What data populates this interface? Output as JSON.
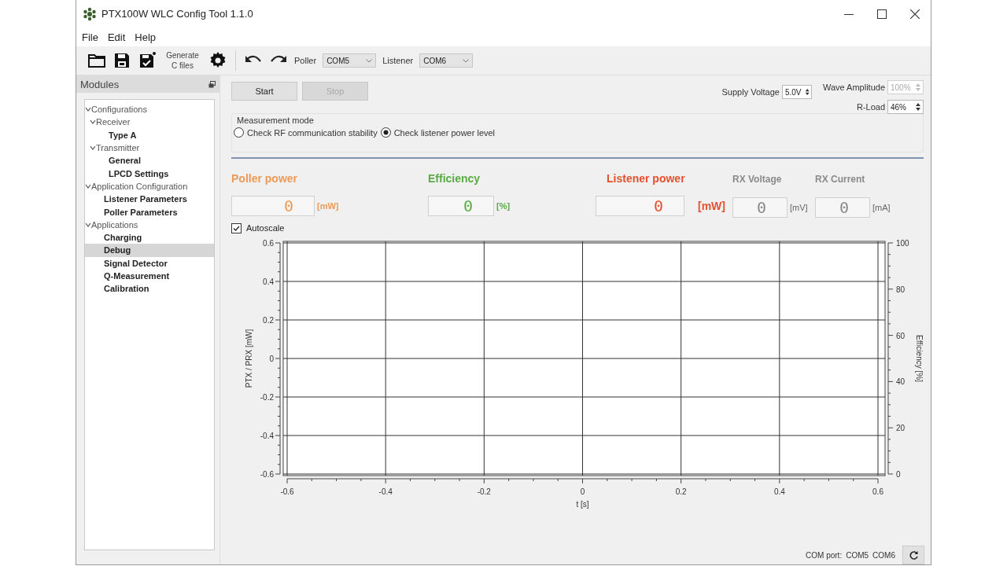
{
  "window": {
    "title": "PTX100W WLC Config Tool 1.1.0"
  },
  "menu": [
    "File",
    "Edit",
    "Help"
  ],
  "toolbar": {
    "generate_label": "Generate C files",
    "poller": {
      "label": "Poller",
      "value": "COM5"
    },
    "listener": {
      "label": "Listener",
      "value": "COM6"
    }
  },
  "modules": {
    "title": "Modules",
    "tree": [
      {
        "label": "Configurations",
        "expanded": true,
        "selected": false,
        "children": [
          {
            "label": "Receiver",
            "expanded": true,
            "selected": false,
            "children": [
              {
                "label": "Type A",
                "selected": false
              }
            ]
          },
          {
            "label": "Transmitter",
            "expanded": true,
            "selected": false,
            "children": [
              {
                "label": "General",
                "selected": false
              },
              {
                "label": "LPCD Settings",
                "selected": false
              }
            ]
          }
        ]
      },
      {
        "label": "Application Configuration",
        "expanded": true,
        "selected": false,
        "children": [
          {
            "label": "Listener Parameters",
            "selected": false
          },
          {
            "label": "Poller Parameters",
            "selected": false
          }
        ]
      },
      {
        "label": "Applications",
        "expanded": true,
        "selected": false,
        "children": [
          {
            "label": "Charging",
            "selected": false
          },
          {
            "label": "Debug",
            "selected": true
          },
          {
            "label": "Signal Detector",
            "selected": false
          },
          {
            "label": "Q-Measurement",
            "selected": false
          },
          {
            "label": "Calibration",
            "selected": false
          }
        ]
      }
    ]
  },
  "controls": {
    "start": {
      "label": "Start",
      "disabled": false
    },
    "stop": {
      "label": "Stop",
      "disabled": true
    },
    "supply_voltage": {
      "label": "Supply Voltage",
      "value": "5.0V",
      "disabled": false
    },
    "wave_amplitude": {
      "label": "Wave Amplitude",
      "value": "100%",
      "disabled": true
    },
    "r_load": {
      "label": "R-Load",
      "value": "46%",
      "disabled": false
    }
  },
  "measurement_mode": {
    "title": "Measurement mode",
    "options": [
      {
        "label": "Check RF communication stability",
        "selected": false
      },
      {
        "label": "Check listener power level",
        "selected": true
      }
    ]
  },
  "readouts": [
    {
      "kind": "primary",
      "label": "Poller power",
      "value": "0",
      "unit": "[mW]",
      "color": "#ec9a55"
    },
    {
      "kind": "primary",
      "label": "Efficiency",
      "value": "0",
      "unit": "[%]",
      "color": "#5aaa45"
    },
    {
      "kind": "main",
      "label": "Listener power",
      "value": "0",
      "unit": "[mW]",
      "color": "#e5512e"
    },
    {
      "kind": "secondary",
      "label": "RX Voltage",
      "value": "0",
      "unit": "[mV]",
      "color": "#8a8a8a"
    },
    {
      "kind": "secondary",
      "label": "RX Current",
      "value": "0",
      "unit": "[mA]",
      "color": "#8a8a8a"
    }
  ],
  "autoscale": {
    "label": "Autoscale",
    "checked": true
  },
  "chart_data": {
    "type": "line",
    "grid": true,
    "xlabel": "t [s]",
    "ylabel": "PTX / PRX [mW]",
    "y2label": "Efficiency [%]",
    "xlim": [
      -0.6,
      0.6
    ],
    "ylim": [
      -0.6,
      0.6
    ],
    "xticks": [
      -0.6,
      -0.4,
      -0.2,
      0,
      0.2,
      0.4,
      0.6
    ],
    "yticks": [
      -0.6,
      -0.4,
      -0.2,
      0,
      0.2,
      0.4,
      0.6
    ],
    "y2lim": [
      0,
      100
    ],
    "y2ticks": [
      0,
      20,
      40,
      60,
      80,
      100
    ]
  },
  "status_bar": {
    "label": "COM port:",
    "ports": [
      "COM5",
      "COM6"
    ]
  }
}
